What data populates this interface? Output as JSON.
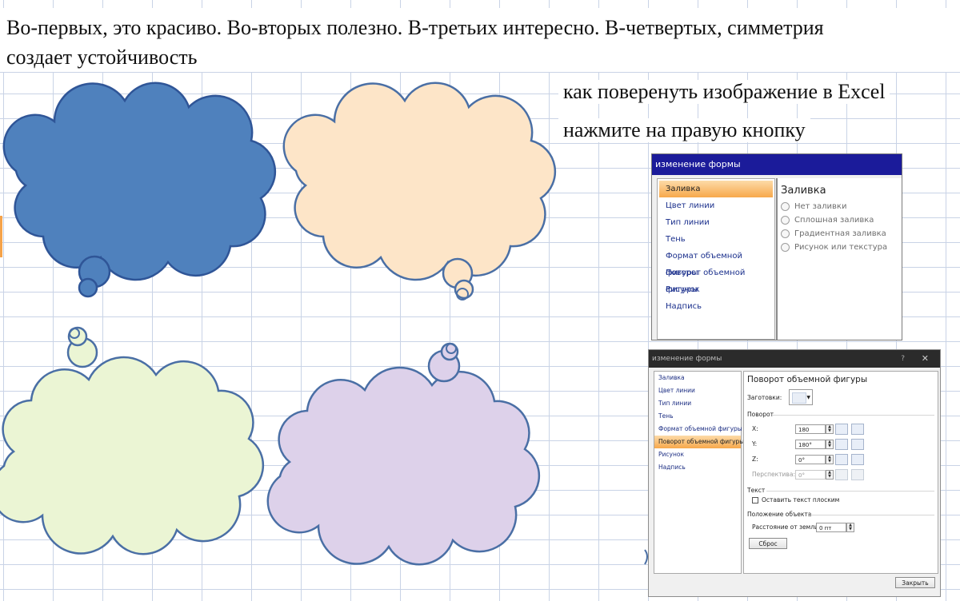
{
  "document": {
    "intro_line1": "Во-первых, это красиво. Во-вторых полезно. В-третьих интересно. В-четвертых, симметрия",
    "intro_line2": "создает устойчивость",
    "note_title": "как поверенуть изображение в Excel",
    "note_instruction": "нажмите на правую кнопку"
  },
  "clouds": [
    {
      "name": "blue-cloud",
      "fill": "#4f81bd",
      "stroke": "#2f5597"
    },
    {
      "name": "peach-cloud",
      "fill": "#fde5c8",
      "stroke": "#4a6fa5"
    },
    {
      "name": "green-cloud",
      "fill": "#ebf5d4",
      "stroke": "#4a6fa5"
    },
    {
      "name": "lavender-cloud",
      "fill": "#ddd1ea",
      "stroke": "#4a6fa5"
    }
  ],
  "dialog1": {
    "title": "изменение формы",
    "menu": [
      "Заливка",
      "Цвет линии",
      "Тип линии",
      "Тень",
      "Формат объемной фигуры",
      "Поворот объемной фигуры",
      "Рисунок",
      "Надпись"
    ],
    "selected": "Заливка",
    "section_title": "Заливка",
    "options": [
      "Нет заливки",
      "Сплошная заливка",
      "Градиентная заливка",
      "Рисунок или текстура"
    ]
  },
  "dialog2": {
    "title": "изменение формы",
    "help": "?",
    "close": "✕",
    "menu": [
      "Заливка",
      "Цвет линии",
      "Тип линии",
      "Тень",
      "Формат объемной фигуры",
      "Поворот объемной фигуры",
      "Рисунок",
      "Надпись"
    ],
    "selected": "Поворот объемной фигуры",
    "section_title": "Поворот объемной фигуры",
    "presets_label": "Заготовки:",
    "rotation_group": "Поворот",
    "x_label": "X:",
    "x_value": "180",
    "y_label": "Y:",
    "y_value": "180°",
    "z_label": "Z:",
    "z_value": "0°",
    "perspective_label": "Перспектива:",
    "perspective_value": "0°",
    "text_group": "Текст",
    "keep_flat_label": "Оставить текст плоским",
    "position_group": "Положение объекта",
    "distance_label": "Расстояние от земли:",
    "distance_value": "0 пт",
    "reset_label": "Сброс",
    "close_label": "Закрыть"
  }
}
